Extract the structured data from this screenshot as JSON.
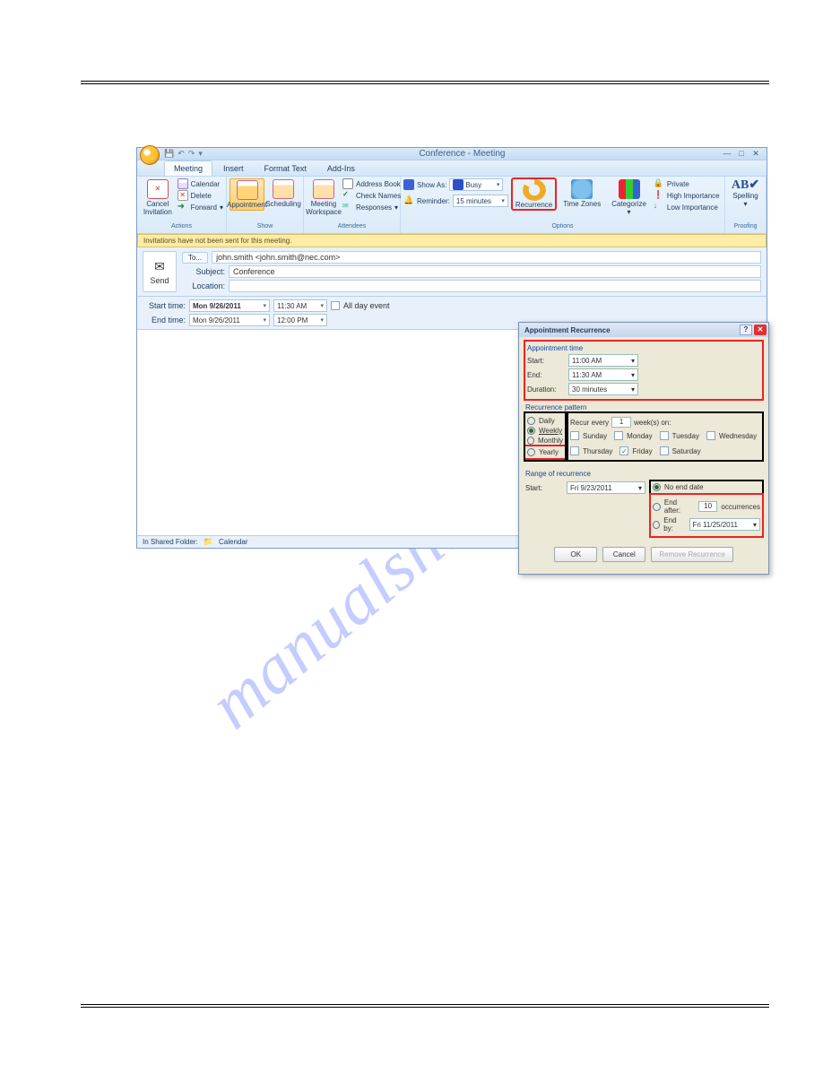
{
  "watermark": "manualshive.com",
  "window": {
    "title": "Conference - Meeting",
    "tabs": [
      "Meeting",
      "Insert",
      "Format Text",
      "Add-Ins"
    ],
    "active_tab": 0
  },
  "ribbon": {
    "groups": {
      "actions": {
        "label": "Actions",
        "cancel": "Cancel Invitation",
        "items": [
          "Calendar",
          "Delete",
          "Forward"
        ]
      },
      "show": {
        "label": "Show",
        "appointment": "Appointment",
        "scheduling": "Scheduling"
      },
      "attendees": {
        "label": "Attendees",
        "meeting_ws": "Meeting Workspace",
        "items": [
          "Address Book",
          "Check Names",
          "Responses"
        ]
      },
      "options": {
        "label": "Options",
        "show_as_label": "Show As:",
        "show_as_value": "Busy",
        "reminder_label": "Reminder:",
        "reminder_value": "15 minutes",
        "recurrence": "Recurrence",
        "time_zones": "Time Zones",
        "categorize": "Categorize",
        "flags": [
          "Private",
          "High Importance",
          "Low Importance"
        ]
      },
      "proofing": {
        "label": "Proofing",
        "spelling": "Spelling"
      }
    }
  },
  "infobar": "Invitations have not been sent for this meeting.",
  "form": {
    "send": "Send",
    "to_btn": "To...",
    "to_value": "john.smith <john.smith@nec.com>",
    "subject_label": "Subject:",
    "subject_value": "Conference",
    "location_label": "Location:",
    "location_value": ""
  },
  "datetime": {
    "start_label": "Start time:",
    "start_date": "Mon 9/26/2011",
    "start_time": "11:30 AM",
    "end_label": "End time:",
    "end_date": "Mon 9/26/2011",
    "end_time": "12:00 PM",
    "all_day": "All day event",
    "all_day_checked": false
  },
  "status": {
    "shared": "In Shared Folder:",
    "folder": "Calendar"
  },
  "dialog": {
    "title": "Appointment Recurrence",
    "appt_time": {
      "legend": "Appointment time",
      "start_label": "Start:",
      "start": "11:00 AM",
      "end_label": "End:",
      "end": "11:30 AM",
      "duration_label": "Duration:",
      "duration": "30 minutes"
    },
    "pattern": {
      "legend": "Recurrence pattern",
      "options": [
        "Daily",
        "Weekly",
        "Monthly",
        "Yearly"
      ],
      "selected": "Weekly",
      "recur_every_pre": "Recur every",
      "recur_every_val": "1",
      "recur_every_post": "week(s) on:",
      "days": [
        "Sunday",
        "Monday",
        "Tuesday",
        "Wednesday",
        "Thursday",
        "Friday",
        "Saturday"
      ],
      "checked_day": "Friday"
    },
    "range": {
      "legend": "Range of recurrence",
      "start_label": "Start:",
      "start": "Fri 9/23/2011",
      "opts": {
        "no_end": "No end date",
        "end_after_pre": "End after:",
        "end_after_val": "10",
        "end_after_post": "occurrences",
        "end_by": "End by:",
        "end_by_val": "Fri 11/25/2011"
      },
      "selected": "no_end"
    },
    "buttons": {
      "ok": "OK",
      "cancel": "Cancel",
      "remove": "Remove Recurrence"
    }
  }
}
